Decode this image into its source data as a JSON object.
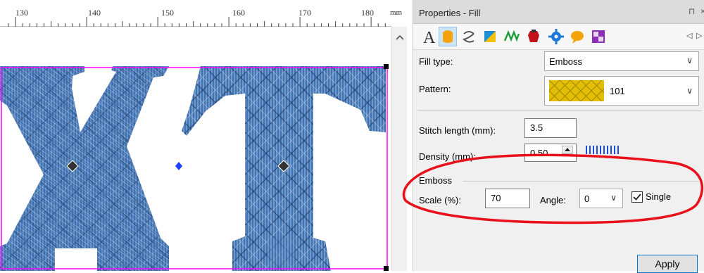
{
  "ruler": {
    "unit": "mm",
    "labels": [
      "130",
      "140",
      "150",
      "160",
      "170",
      "180"
    ]
  },
  "design": {
    "letters": [
      "X",
      "T"
    ],
    "stitch_color": "#3d6fb0",
    "selection_color": "#ff00ff"
  },
  "panel": {
    "title": "Properties - Fill",
    "pin_glyph": "⊓",
    "toolbar_icons": [
      "text-icon",
      "fill-icon",
      "outline-icon",
      "color-icon",
      "stitch-icon",
      "applique-icon",
      "settings-icon",
      "tooltip-icon",
      "pattern-icon"
    ],
    "nav_left": "◁",
    "nav_right": "▷",
    "fill_type": {
      "label": "Fill type:",
      "value": "Emboss"
    },
    "pattern": {
      "label": "Pattern:",
      "value": "101",
      "swatch_color": "#e6c200"
    },
    "stitch_length": {
      "label": "Stitch length (mm):",
      "value": "3.5"
    },
    "density": {
      "label": "Density (mm):",
      "value": "0.50"
    },
    "emboss": {
      "group_label": "Emboss",
      "scale_label": "Scale (%):",
      "scale_value": "70",
      "angle_label": "Angle:",
      "angle_value": "0",
      "single_label": "Single",
      "single_checked": true
    },
    "apply_label": "Apply"
  },
  "annotation_color": "#e8101a"
}
